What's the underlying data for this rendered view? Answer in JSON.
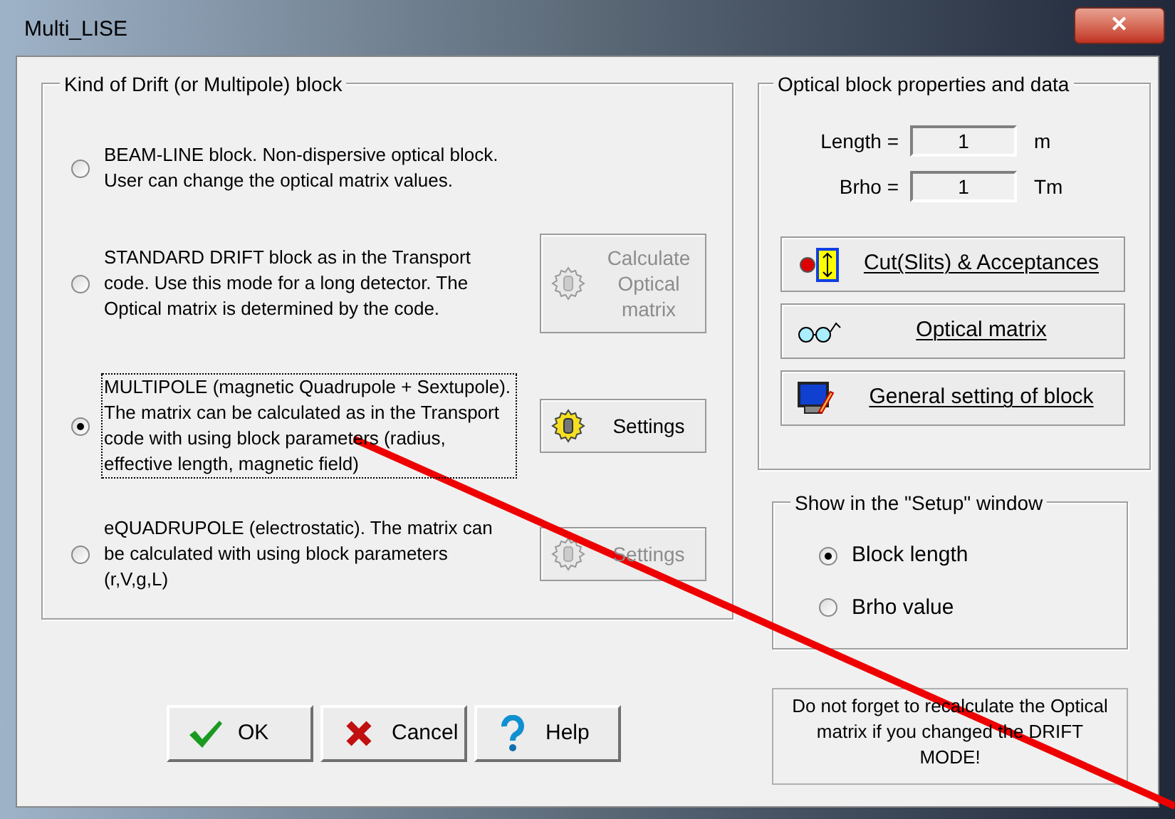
{
  "window": {
    "title": "Multi_LISE",
    "close": "✕"
  },
  "drift_group": {
    "title": "Kind of Drift (or Multipole) block",
    "options": [
      {
        "label": "BEAM-LINE block. Non-dispersive optical block. User can change the optical matrix values.",
        "selected": false
      },
      {
        "label": "STANDARD DRIFT block as in the Transport code. Use this mode for a long detector. The Optical matrix is determined by the code.",
        "selected": false,
        "button": {
          "label": "Calculate Optical matrix",
          "disabled": true
        }
      },
      {
        "label": "MULTIPOLE (magnetic Quadrupole + Sextupole). The matrix can be calculated as in the Transport code with using block parameters  (radius, effective length, magnetic field)",
        "selected": true,
        "focused": true,
        "button": {
          "label": "Settings",
          "disabled": false
        }
      },
      {
        "label": "eQUADRUPOLE (electrostatic). The matrix can be calculated with using block parameters  (r,V,g,L)",
        "selected": false,
        "button": {
          "label": "Settings",
          "disabled": true
        }
      }
    ]
  },
  "properties_group": {
    "title": "Optical block properties and data",
    "fields": [
      {
        "label": "Length =",
        "value": "1",
        "unit": "m"
      },
      {
        "label": "Brho =",
        "value": "1",
        "unit": "Tm"
      }
    ],
    "buttons": [
      {
        "kind": "slits",
        "label": "Cut(Slits) & Acceptances"
      },
      {
        "kind": "glasses",
        "label": "Optical matrix"
      },
      {
        "kind": "monitor",
        "label": "General setting of block"
      }
    ]
  },
  "setup_group": {
    "title": "Show in the \"Setup\" window",
    "options": [
      {
        "label": "Block length",
        "selected": true
      },
      {
        "label": "Brho value",
        "selected": false
      }
    ]
  },
  "note": "Do not forget to recalculate the Optical matrix if you changed the DRIFT MODE!",
  "dialog_buttons": [
    {
      "kind": "ok",
      "label": "OK"
    },
    {
      "kind": "cancel",
      "label": "Cancel"
    },
    {
      "kind": "help",
      "label": "Help"
    }
  ]
}
